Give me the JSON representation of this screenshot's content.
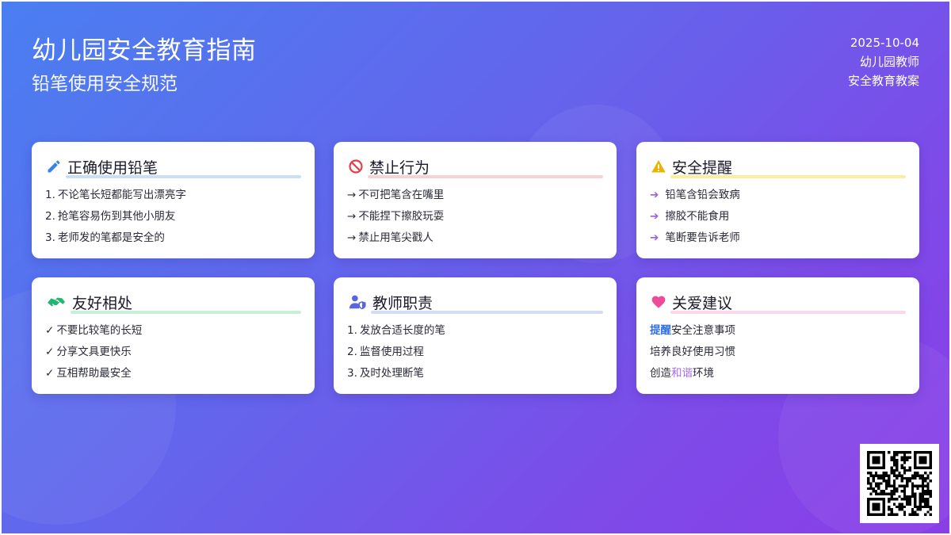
{
  "header": {
    "title": "幼儿园安全教育指南",
    "subtitle": "铅笔使用安全规范",
    "date": "2025-10-04",
    "author": "幼儿园教师",
    "doc_type": "安全教育教案"
  },
  "cards": [
    {
      "icon": "pencil-icon",
      "title": "正确使用铅笔",
      "underline_color": "#c9def7",
      "items": [
        {
          "prefix": "1.",
          "text": "不论笔长短都能写出漂亮字"
        },
        {
          "prefix": "2.",
          "text": "抢笔容易伤到其他小朋友"
        },
        {
          "prefix": "3.",
          "text": "老师发的笔都是安全的"
        }
      ]
    },
    {
      "icon": "ban-icon",
      "title": "禁止行为",
      "underline_color": "#f7d3d6",
      "items": [
        {
          "prefix": "→",
          "text": "不可把笔含在嘴里"
        },
        {
          "prefix": "→",
          "text": "不能捏下擦胶玩耍"
        },
        {
          "prefix": "→",
          "text": "禁止用笔尖戳人"
        }
      ]
    },
    {
      "icon": "warning-icon",
      "title": "安全提醒",
      "underline_color": "#fbeea0",
      "items": [
        {
          "prefix": "➔",
          "text": "铅笔含铅会致病"
        },
        {
          "prefix": "➔",
          "text": "擦胶不能食用"
        },
        {
          "prefix": "➔",
          "text": "笔断要告诉老师"
        }
      ]
    },
    {
      "icon": "handshake-icon",
      "title": "友好相处",
      "underline_color": "#c8f0d8",
      "items": [
        {
          "prefix": "✓",
          "text": "不要比较笔的长短"
        },
        {
          "prefix": "✓",
          "text": "分享文具更快乐"
        },
        {
          "prefix": "✓",
          "text": "互相帮助最安全"
        }
      ]
    },
    {
      "icon": "teacher-shield-icon",
      "title": "教师职责",
      "underline_color": "#d5dcf3",
      "items": [
        {
          "prefix": "1.",
          "text": "发放合适长度的笔"
        },
        {
          "prefix": "2.",
          "text": "监督使用过程"
        },
        {
          "prefix": "3.",
          "text": "及时处理断笔"
        }
      ]
    },
    {
      "icon": "heart-icon",
      "title": "关爱建议",
      "underline_color": "#f8d8ea",
      "items": [
        {
          "highlight": "提醒",
          "text": "安全注意事项"
        },
        {
          "text": "培养良好使用习惯"
        },
        {
          "before": "创造",
          "highlight2": "和谐",
          "after": "环境"
        }
      ]
    }
  ],
  "qr_code": {
    "label": "qr-code"
  }
}
